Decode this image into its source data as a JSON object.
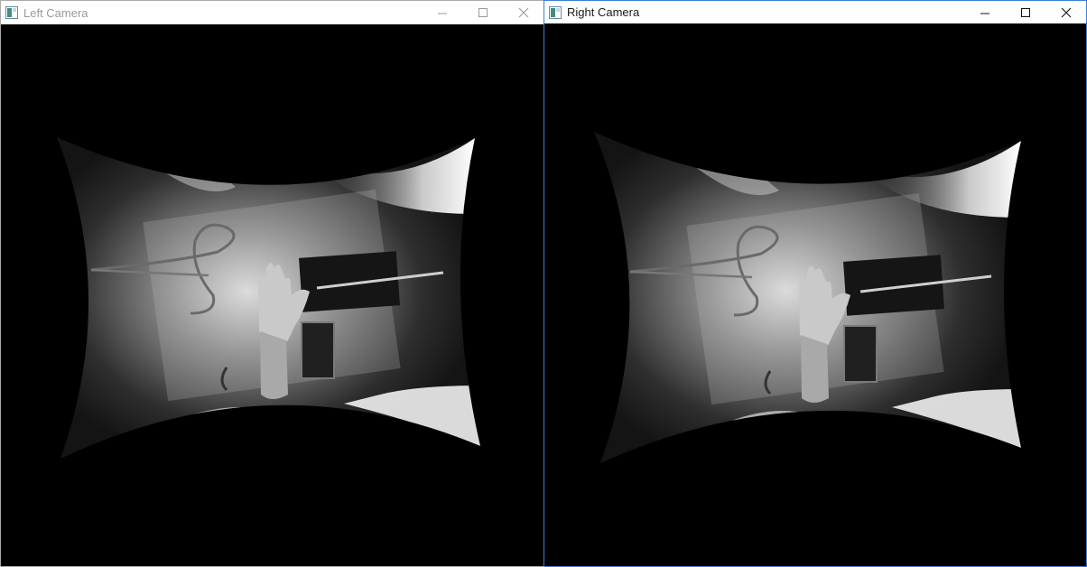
{
  "windows": {
    "left": {
      "title": "Left Camera",
      "active": false
    },
    "right": {
      "title": "Right Camera",
      "active": true
    }
  },
  "controls": {
    "minimize": "minimize-icon",
    "maximize": "maximize-icon",
    "close": "close-icon"
  },
  "colors": {
    "frame_inactive": "#aaaaaa",
    "frame_active": "#3c7fd6",
    "viewport": "#000000"
  }
}
